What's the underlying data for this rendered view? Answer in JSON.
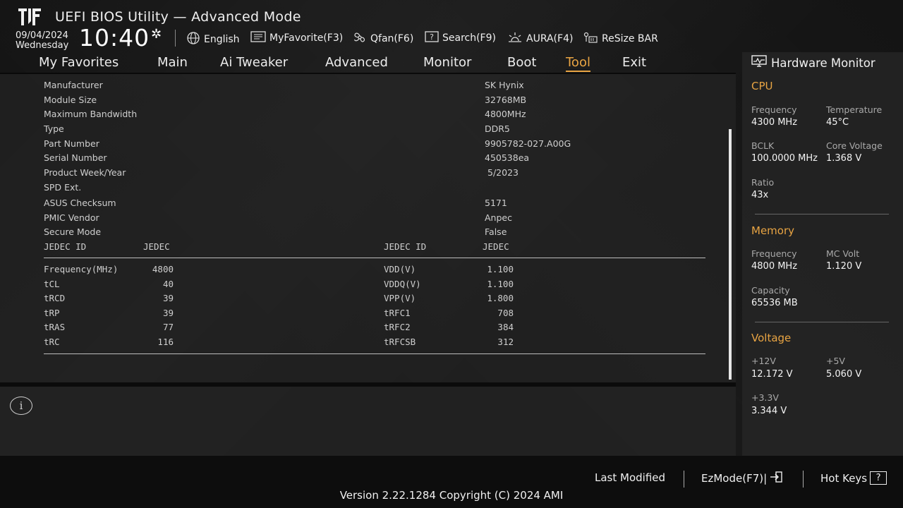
{
  "header": {
    "title": "UEFI BIOS Utility — Advanced Mode",
    "date": "09/04/2024",
    "weekday": "Wednesday",
    "time": "10:40",
    "toolbar": [
      {
        "label": "English",
        "icon": "globe-icon"
      },
      {
        "label": "MyFavorite(F3)",
        "icon": "favorite-icon"
      },
      {
        "label": "Qfan(F6)",
        "icon": "fan-icon"
      },
      {
        "label": "Search(F9)",
        "icon": "search-icon"
      },
      {
        "label": "AURA(F4)",
        "icon": "aura-icon"
      },
      {
        "label": "ReSize BAR",
        "icon": "resize-bar-icon"
      }
    ]
  },
  "tabs": [
    "My Favorites",
    "Main",
    "Ai Tweaker",
    "Advanced",
    "Monitor",
    "Boot",
    "Tool",
    "Exit"
  ],
  "active_tab": "Tool",
  "accent_color": "#e8a443",
  "spd_info": [
    {
      "label": "Manufacturer",
      "value": "SK Hynix"
    },
    {
      "label": "Module Size",
      "value": "32768MB"
    },
    {
      "label": "Maximum Bandwidth",
      "value": "4800MHz"
    },
    {
      "label": "Type",
      "value": "DDR5"
    },
    {
      "label": "Part Number",
      "value": "9905782-027.A00G"
    },
    {
      "label": "Serial Number",
      "value": "450538ea"
    },
    {
      "label": "Product Week/Year",
      "value": "5/2023"
    },
    {
      "label": "SPD Ext.",
      "value": ""
    },
    {
      "label": "ASUS Checksum",
      "value": "5171"
    },
    {
      "label": "PMIC Vendor",
      "value": "Anpec"
    },
    {
      "label": "Secure Mode",
      "value": "False"
    }
  ],
  "jedec": {
    "left_header": [
      "JEDEC ID",
      "JEDEC"
    ],
    "right_header": [
      "JEDEC ID",
      "JEDEC"
    ],
    "left": [
      {
        "label": "Frequency(MHz)",
        "value": "4800"
      },
      {
        "label": "tCL",
        "value": "40"
      },
      {
        "label": "tRCD",
        "value": "39"
      },
      {
        "label": "tRP",
        "value": "39"
      },
      {
        "label": "tRAS",
        "value": "77"
      },
      {
        "label": "tRC",
        "value": "116"
      }
    ],
    "right": [
      {
        "label": "VDD(V)",
        "value": "1.100"
      },
      {
        "label": "VDDQ(V)",
        "value": "1.100"
      },
      {
        "label": "VPP(V)",
        "value": "1.800"
      },
      {
        "label": "tRFC1",
        "value": "708"
      },
      {
        "label": "tRFC2",
        "value": "384"
      },
      {
        "label": "tRFCSB",
        "value": "312"
      }
    ]
  },
  "hw_monitor": {
    "title": "Hardware Monitor",
    "cpu": {
      "heading": "CPU",
      "frequency_label": "Frequency",
      "frequency": "4300 MHz",
      "temperature_label": "Temperature",
      "temperature": "45°C",
      "bclk_label": "BCLK",
      "bclk": "100.0000 MHz",
      "core_voltage_label": "Core Voltage",
      "core_voltage": "1.368 V",
      "ratio_label": "Ratio",
      "ratio": "43x"
    },
    "memory": {
      "heading": "Memory",
      "frequency_label": "Frequency",
      "frequency": "4800 MHz",
      "mc_volt_label": "MC Volt",
      "mc_volt": "1.120 V",
      "capacity_label": "Capacity",
      "capacity": "65536 MB"
    },
    "voltage": {
      "heading": "Voltage",
      "v12_label": "+12V",
      "v12": "12.172 V",
      "v5_label": "+5V",
      "v5": "5.060 V",
      "v33_label": "+3.3V",
      "v33": "3.344 V"
    }
  },
  "footer": {
    "last_modified": "Last Modified",
    "ezmode": "EzMode(F7)|",
    "hot_keys": "Hot Keys",
    "hot_keys_glyph": "?",
    "version": "Version 2.22.1284 Copyright (C) 2024 AMI"
  }
}
